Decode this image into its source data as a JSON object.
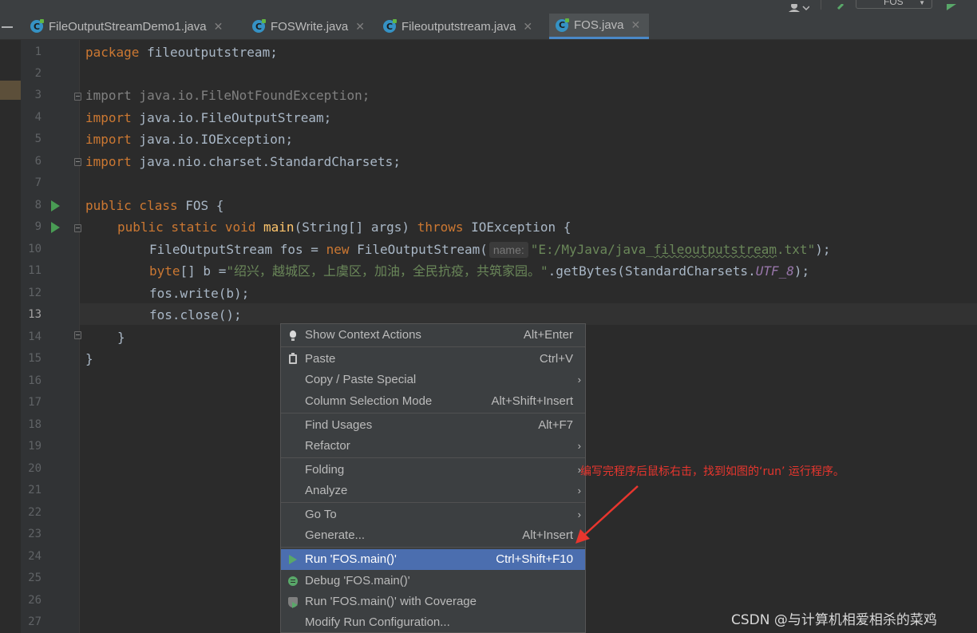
{
  "tabs": [
    {
      "label": "FileOutputStreamDemo1.java",
      "active": false
    },
    {
      "label": "FOSWrite.java",
      "active": false
    },
    {
      "label": "Fileoutputstream.java",
      "active": false
    },
    {
      "label": "FOS.java",
      "active": true
    }
  ],
  "toolbar": {
    "run_config_label": "FOS"
  },
  "editor": {
    "line_numbers": [
      "1",
      "2",
      "3",
      "4",
      "5",
      "6",
      "7",
      "8",
      "9",
      "10",
      "11",
      "12",
      "13",
      "14",
      "15",
      "16",
      "17",
      "18",
      "19",
      "20",
      "21",
      "22",
      "23",
      "24",
      "25",
      "26",
      "27"
    ],
    "current_line": "13",
    "code": {
      "l1_kw": "package",
      "l1_rest": " fileoutputstream;",
      "l3": "import java.io.FileNotFoundException;",
      "import_kw": "import",
      "l4_rest": " java.io.FileOutputStream;",
      "l5_rest": " java.io.IOException;",
      "l6_rest": " java.nio.charset.StandardCharsets;",
      "l8_kw": "public class",
      "l8_rest": " FOS {",
      "l9_kw1": "public static void",
      "l9_fn": "main",
      "l9_mid": "(String[] args) ",
      "l9_kw2": "throws",
      "l9_rest": " IOException {",
      "l10_pre": "FileOutputStream fos = ",
      "l10_kw": "new",
      "l10_mid": " FileOutputStream(",
      "l10_hint": "name:",
      "l10_str_a": "\"E:/MyJava/java_",
      "l10_str_b": "fileoutputstream",
      "l10_str_c": ".txt\"",
      "l10_end": ");",
      "l11_kw": "byte",
      "l11_mid": "[] b =",
      "l11_str": "\"绍兴，越城区，上虞区，加油，全民抗疫，共筑家园。\"",
      "l11_mid2": ".getBytes(StandardCharsets.",
      "l11_const": "UTF_8",
      "l11_end": ");",
      "l12": "fos.write(b);",
      "l13": "fos.close();",
      "l14": "}",
      "l15": "}"
    }
  },
  "context_menu": {
    "items": [
      {
        "label": "Show Context Actions",
        "shortcut": "Alt+Enter",
        "icon": "lightbulb-icon"
      },
      {
        "label": "Paste",
        "shortcut": "Ctrl+V",
        "icon": "clipboard-icon"
      },
      {
        "label": "Copy / Paste Special",
        "shortcut": "",
        "submenu": true
      },
      {
        "label": "Column Selection Mode",
        "shortcut": "Alt+Shift+Insert"
      },
      {
        "label": "Find Usages",
        "shortcut": "Alt+F7"
      },
      {
        "label": "Refactor",
        "shortcut": "",
        "submenu": true
      },
      {
        "label": "Folding",
        "shortcut": "",
        "submenu": true
      },
      {
        "label": "Analyze",
        "shortcut": "",
        "submenu": true
      },
      {
        "label": "Go To",
        "shortcut": "",
        "submenu": true
      },
      {
        "label": "Generate...",
        "shortcut": "Alt+Insert"
      },
      {
        "label": "Run 'FOS.main()'",
        "shortcut": "Ctrl+Shift+F10",
        "icon": "run-icon",
        "selected": true
      },
      {
        "label": "Debug 'FOS.main()'",
        "shortcut": "",
        "icon": "debug-icon"
      },
      {
        "label": "Run 'FOS.main()' with Coverage",
        "shortcut": "",
        "icon": "coverage-icon"
      },
      {
        "label": "Modify Run Configuration...",
        "shortcut": ""
      }
    ]
  },
  "annotation": {
    "text": "编写完程序后鼠标右击，找到如图的‘run’ 运行程序。",
    "color": "#e8362e"
  },
  "watermark": "CSDN @与计算机相爱相杀的菜鸡",
  "colors": {
    "accent": "#4b6eaf",
    "tab_underline": "#4a88c7",
    "keyword": "#cc7832",
    "string": "#6a8759",
    "function": "#ffc66d",
    "run_green": "#499c54"
  }
}
